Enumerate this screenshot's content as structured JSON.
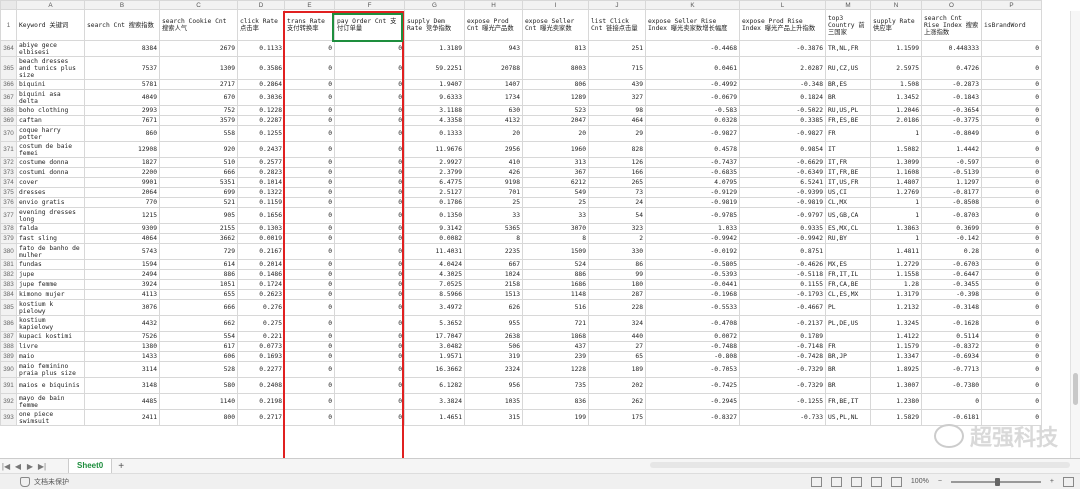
{
  "columns": [
    "A",
    "B",
    "C",
    "D",
    "E",
    "F",
    "G",
    "H",
    "I",
    "J",
    "K",
    "L",
    "M",
    "N",
    "O",
    "P"
  ],
  "headers": [
    "Keyword 关键词",
    "search Cnt 搜索指数",
    "search Cookie Cnt 搜索人气",
    "click Rate 点击率",
    "trans Rate 支付转换率",
    "pay Order Cnt 支付订单量",
    "supply Dem Rate 竞争指数",
    "expose Prod Cnt 曝光产品数",
    "expose Seller Cnt 曝光卖家数",
    "list Click Cnt 链接点击量",
    "expose Seller Rise Index 曝光卖家数增长幅度",
    "expose Prod Rise Index 曝光产品上升指数",
    "top3 Country 前三国家",
    "supply Rate 供应率",
    "search Cnt Rise Index 搜索上涨指数",
    "isBrandWord"
  ],
  "rows": [
    {
      "n": "364",
      "h": 1,
      "c": [
        "abiye gece elbisesi",
        "8384",
        "2679",
        "0.1133",
        "0",
        "0",
        "1.3189",
        "943",
        "813",
        "251",
        "-0.4468",
        "-0.3876",
        "TR,NL,FR",
        "1.1599",
        "0.448333",
        "0"
      ]
    },
    {
      "n": "365",
      "h": 2,
      "c": [
        "beach dresses and tunics plus size",
        "7537",
        "1309",
        "0.3586",
        "0",
        "0",
        "59.2251",
        "20788",
        "8003",
        "715",
        "0.0461",
        "2.0287",
        "RU,CZ,US",
        "2.5975",
        "0.4726",
        "0"
      ]
    },
    {
      "n": "366",
      "h": 0,
      "c": [
        "biquini",
        "5781",
        "2717",
        "0.2864",
        "0",
        "0",
        "1.9407",
        "1407",
        "806",
        "439",
        "-0.4992",
        "-0.348",
        "BR,ES",
        "1.508",
        "-0.2873",
        "0"
      ]
    },
    {
      "n": "367",
      "h": 1,
      "c": [
        "biquini asa delta",
        "4049",
        "670",
        "0.3036",
        "0",
        "0",
        "9.6333",
        "1734",
        "1289",
        "327",
        "-0.0679",
        "0.1824",
        "BR",
        "1.3452",
        "-0.1843",
        "0"
      ]
    },
    {
      "n": "368",
      "h": 0,
      "c": [
        "boho clothing",
        "2993",
        "752",
        "0.1228",
        "0",
        "0",
        "3.1188",
        "630",
        "523",
        "98",
        "-0.583",
        "-0.5022",
        "RU,US,PL",
        "1.2046",
        "-0.3654",
        "0"
      ]
    },
    {
      "n": "369",
      "h": 0,
      "c": [
        "caftan",
        "7671",
        "3579",
        "0.2287",
        "0",
        "0",
        "4.3358",
        "4132",
        "2047",
        "464",
        "0.0328",
        "0.3385",
        "FR,ES,BE",
        "2.0186",
        "-0.3775",
        "0"
      ]
    },
    {
      "n": "370",
      "h": 1,
      "c": [
        "coque harry potter",
        "860",
        "558",
        "0.1255",
        "0",
        "0",
        "0.1333",
        "20",
        "20",
        "29",
        "-0.9827",
        "-0.9827",
        "FR",
        "1",
        "-0.8049",
        "0"
      ]
    },
    {
      "n": "371",
      "h": 1,
      "c": [
        "costum de baie femei",
        "12908",
        "920",
        "0.2437",
        "0",
        "0",
        "11.9676",
        "2956",
        "1960",
        "828",
        "0.4578",
        "0.9854",
        "IT",
        "1.5082",
        "1.4442",
        "0"
      ]
    },
    {
      "n": "372",
      "h": 0,
      "c": [
        "costume donna",
        "1827",
        "510",
        "0.2577",
        "0",
        "0",
        "2.9927",
        "410",
        "313",
        "126",
        "-0.7437",
        "-0.6629",
        "IT,FR",
        "1.3099",
        "-0.597",
        "0"
      ]
    },
    {
      "n": "373",
      "h": 0,
      "c": [
        "costumi donna",
        "2200",
        "666",
        "0.2823",
        "0",
        "0",
        "2.3799",
        "426",
        "367",
        "166",
        "-0.6835",
        "-0.6349",
        "IT,FR,BE",
        "1.1608",
        "-0.5139",
        "0"
      ]
    },
    {
      "n": "374",
      "h": 0,
      "c": [
        "cover",
        "9901",
        "5351",
        "0.1014",
        "0",
        "0",
        "6.4775",
        "9198",
        "6212",
        "265",
        "4.0795",
        "6.5241",
        "IT,US,FR",
        "1.4807",
        "1.1297",
        "0"
      ]
    },
    {
      "n": "375",
      "h": 0,
      "c": [
        "dresses",
        "2064",
        "699",
        "0.1322",
        "0",
        "0",
        "2.5127",
        "701",
        "549",
        "73",
        "-0.9129",
        "-0.9399",
        "US,CI",
        "1.2769",
        "-0.8177",
        "0"
      ]
    },
    {
      "n": "376",
      "h": 0,
      "c": [
        "envio gratis",
        "770",
        "521",
        "0.1159",
        "0",
        "0",
        "0.1786",
        "25",
        "25",
        "24",
        "-0.9819",
        "-0.9819",
        "CL,MX",
        "1",
        "-0.8508",
        "0"
      ]
    },
    {
      "n": "377",
      "h": 1,
      "c": [
        "evening dresses long",
        "1215",
        "905",
        "0.1656",
        "0",
        "0",
        "0.1350",
        "33",
        "33",
        "54",
        "-0.9785",
        "-0.9797",
        "US,GB,CA",
        "1",
        "-0.8703",
        "0"
      ]
    },
    {
      "n": "378",
      "h": 0,
      "c": [
        "falda",
        "9309",
        "2155",
        "0.1303",
        "0",
        "0",
        "9.3142",
        "5365",
        "3070",
        "323",
        "1.033",
        "0.9335",
        "ES,MX,CL",
        "1.3863",
        "0.3699",
        "0"
      ]
    },
    {
      "n": "379",
      "h": 0,
      "c": [
        "fast sling",
        "4064",
        "3662",
        "0.0019",
        "0",
        "0",
        "0.0082",
        "8",
        "8",
        "2",
        "-0.9942",
        "-0.9942",
        "RU,BY",
        "1",
        "-0.142",
        "0"
      ]
    },
    {
      "n": "380",
      "h": 1,
      "c": [
        "fato de banho de mulher",
        "5743",
        "729",
        "0.2167",
        "0",
        "0",
        "11.4031",
        "2235",
        "1509",
        "330",
        "-0.0192",
        "0.8751",
        "",
        "1.4811",
        "0.28",
        "0"
      ]
    },
    {
      "n": "381",
      "h": 0,
      "c": [
        "fundas",
        "1594",
        "614",
        "0.2014",
        "0",
        "0",
        "4.0424",
        "667",
        "524",
        "86",
        "-0.5805",
        "-0.4626",
        "MX,ES",
        "1.2729",
        "-0.6703",
        "0"
      ]
    },
    {
      "n": "382",
      "h": 0,
      "c": [
        "jupe",
        "2494",
        "886",
        "0.1486",
        "0",
        "0",
        "4.3025",
        "1024",
        "886",
        "99",
        "-0.5393",
        "-0.5118",
        "FR,IT,IL",
        "1.1558",
        "-0.6447",
        "0"
      ]
    },
    {
      "n": "383",
      "h": 0,
      "c": [
        "jupe femme",
        "3924",
        "1051",
        "0.1724",
        "0",
        "0",
        "7.0525",
        "2158",
        "1686",
        "180",
        "-0.0441",
        "0.1155",
        "FR,CA,BE",
        "1.28",
        "-0.3455",
        "0"
      ]
    },
    {
      "n": "384",
      "h": 0,
      "c": [
        "kimono mujer",
        "4113",
        "655",
        "0.2623",
        "0",
        "0",
        "8.5966",
        "1513",
        "1148",
        "287",
        "-0.1968",
        "-0.1793",
        "CL,ES,MX",
        "1.3179",
        "-0.398",
        "0"
      ]
    },
    {
      "n": "385",
      "h": 1,
      "c": [
        "kostium k pielowy",
        "3076",
        "666",
        "0.276",
        "0",
        "0",
        "3.4972",
        "626",
        "516",
        "228",
        "-0.5533",
        "-0.4667",
        "PL",
        "1.2132",
        "-0.3148",
        "0"
      ]
    },
    {
      "n": "386",
      "h": 1,
      "c": [
        "kostium kapielowy",
        "4432",
        "662",
        "0.275",
        "0",
        "0",
        "5.3652",
        "955",
        "721",
        "324",
        "-0.4708",
        "-0.2137",
        "PL,DE,US",
        "1.3245",
        "-0.1628",
        "0"
      ]
    },
    {
      "n": "387",
      "h": 0,
      "c": [
        "kupaci kostimi",
        "7526",
        "554",
        "0.221",
        "0",
        "0",
        "17.7047",
        "2638",
        "1868",
        "440",
        "0.0072",
        "0.1789",
        "",
        "1.4122",
        "0.5114",
        "0"
      ]
    },
    {
      "n": "388",
      "h": 0,
      "c": [
        "livre",
        "1380",
        "617",
        "0.0773",
        "0",
        "0",
        "3.0482",
        "506",
        "437",
        "27",
        "-0.7488",
        "-0.7148",
        "FR",
        "1.1579",
        "-0.8372",
        "0"
      ]
    },
    {
      "n": "389",
      "h": 0,
      "c": [
        "maio",
        "1433",
        "606",
        "0.1693",
        "0",
        "0",
        "1.9571",
        "319",
        "239",
        "65",
        "-0.808",
        "-0.7428",
        "BR,JP",
        "1.3347",
        "-0.6934",
        "0"
      ]
    },
    {
      "n": "390",
      "h": 1,
      "c": [
        "maio feminino praia plus size",
        "3114",
        "528",
        "0.2277",
        "0",
        "0",
        "16.3662",
        "2324",
        "1228",
        "189",
        "-0.7053",
        "-0.7329",
        "BR",
        "1.8925",
        "-0.7713",
        "0"
      ]
    },
    {
      "n": "391",
      "h": 1,
      "c": [
        "maios e biquinis",
        "3148",
        "580",
        "0.2408",
        "0",
        "0",
        "6.1282",
        "956",
        "735",
        "202",
        "-0.7425",
        "-0.7329",
        "BR",
        "1.3007",
        "-0.7380",
        "0"
      ]
    },
    {
      "n": "392",
      "h": 1,
      "c": [
        "mayo de bain femme",
        "4485",
        "1140",
        "0.2198",
        "0",
        "0",
        "3.3824",
        "1035",
        "836",
        "262",
        "-0.2945",
        "-0.1255",
        "FR,BE,IT",
        "1.2380",
        "0",
        "0"
      ]
    },
    {
      "n": "393",
      "h": 1,
      "c": [
        "one piece swimsuit",
        "2411",
        "800",
        "0.2717",
        "0",
        "0",
        "1.4651",
        "315",
        "199",
        "175",
        "-0.8327",
        "-0.733",
        "US,PL,NL",
        "1.5829",
        "-0.6181",
        "0"
      ]
    }
  ],
  "watermark": "超强科技",
  "sheet_tab": "Sheet0",
  "status_text": "文档未保护",
  "zoom": "100%"
}
